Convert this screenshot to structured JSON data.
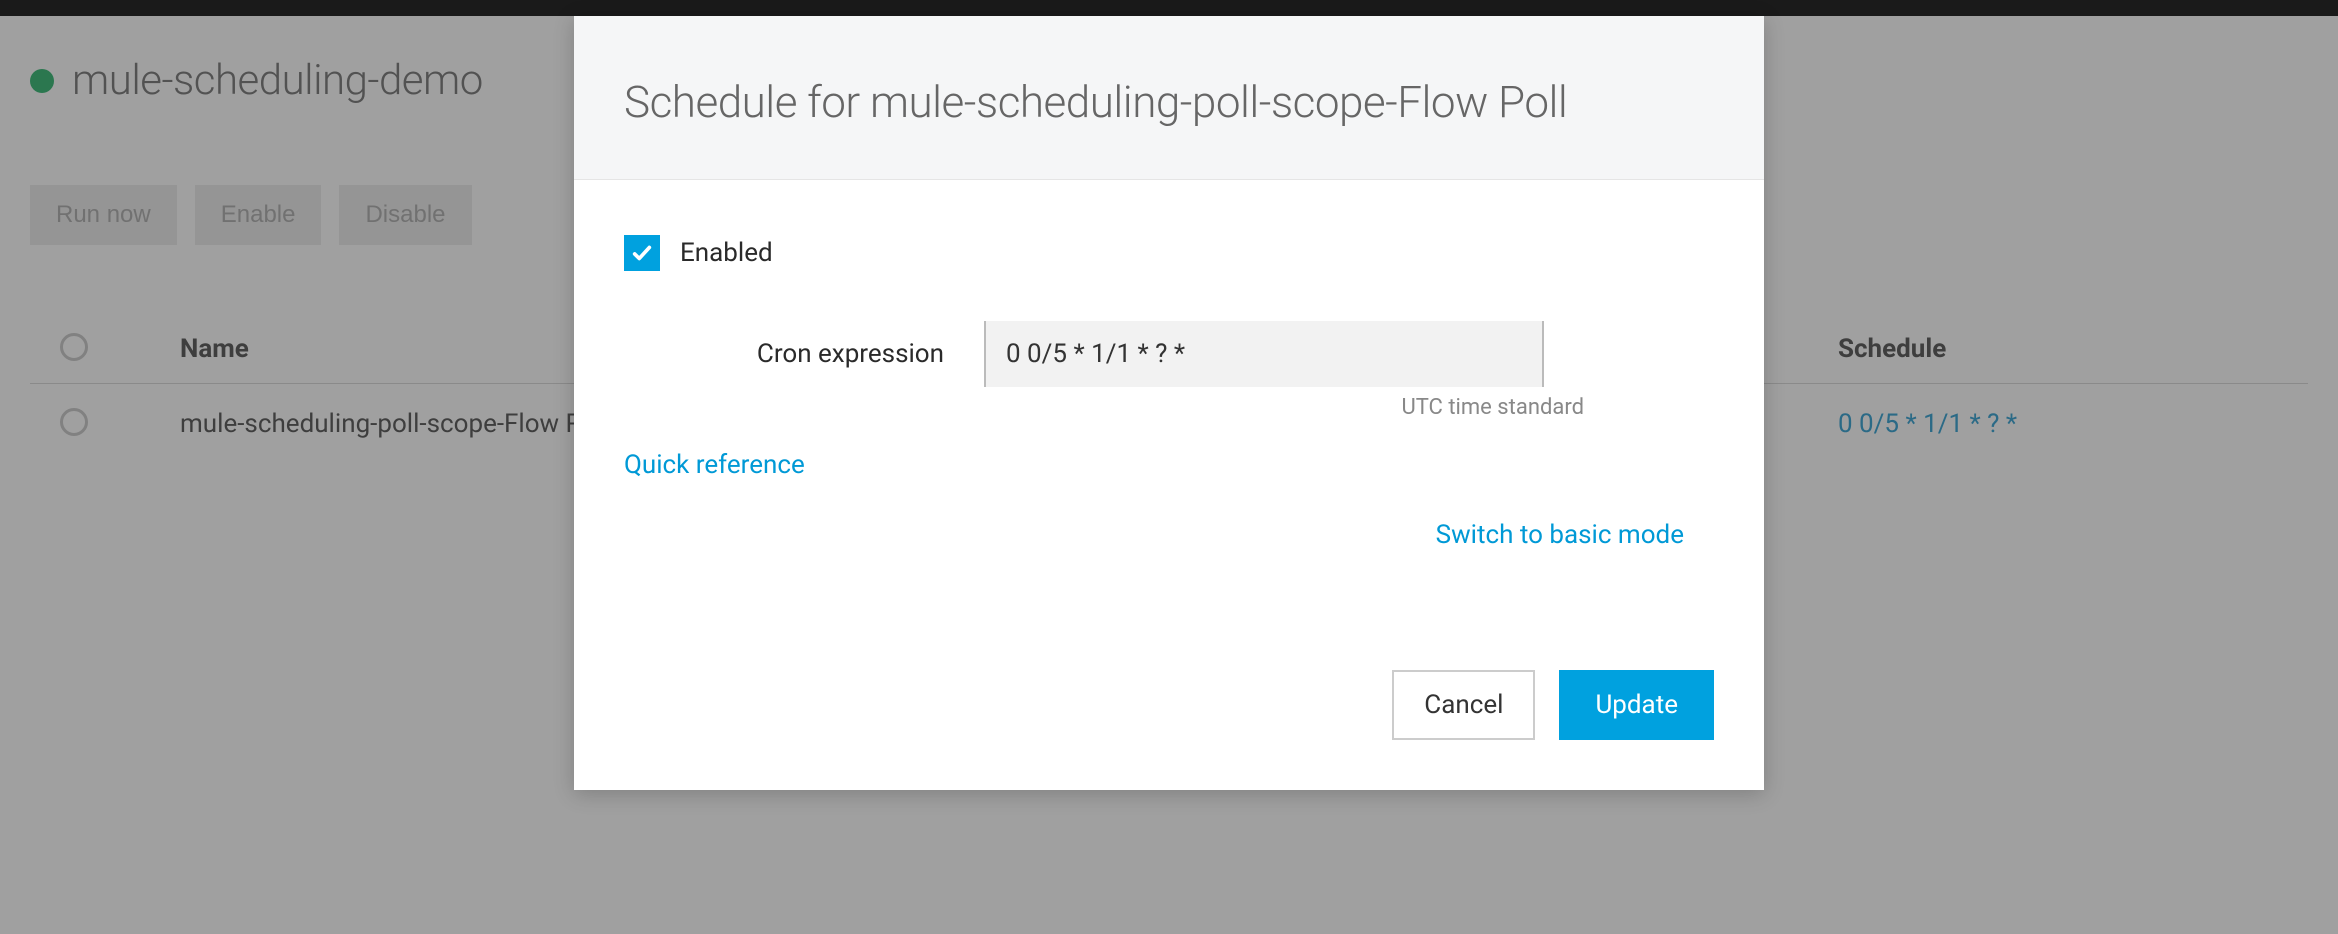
{
  "page": {
    "title": "mule-scheduling-demo",
    "actions": {
      "run_now": "Run now",
      "enable": "Enable",
      "disable": "Disable"
    },
    "table": {
      "headers": {
        "name": "Name",
        "schedule": "Schedule"
      },
      "rows": [
        {
          "name": "mule-scheduling-poll-scope-Flow Poll",
          "schedule": "0 0/5 * 1/1 * ? *"
        }
      ]
    }
  },
  "modal": {
    "title": "Schedule for mule-scheduling-poll-scope-Flow Poll",
    "enabled_label": "Enabled",
    "enabled_checked": true,
    "cron": {
      "label": "Cron expression",
      "value": "0 0/5 * 1/1 * ? *",
      "hint": "UTC time standard"
    },
    "links": {
      "quick_reference": "Quick reference",
      "switch_basic": "Switch to basic mode"
    },
    "buttons": {
      "cancel": "Cancel",
      "update": "Update"
    }
  }
}
